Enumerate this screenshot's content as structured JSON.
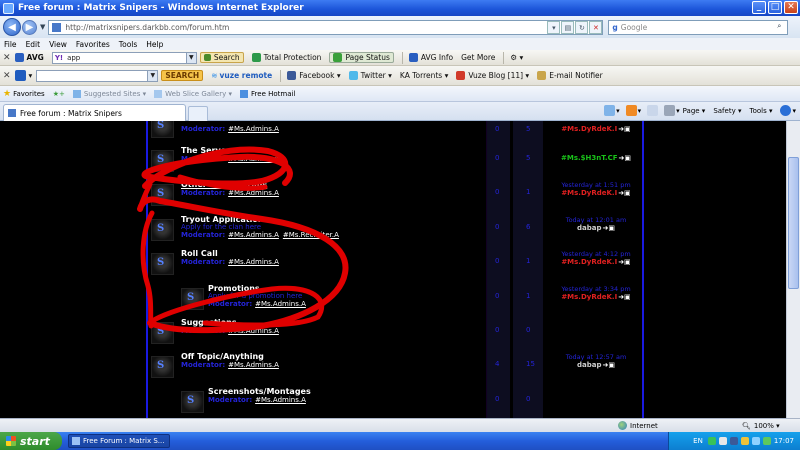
{
  "window": {
    "title": "Free forum : Matrix Snipers - Windows Internet Explorer",
    "url": "http://matrixsnipers.darkbb.com/forum.htm",
    "search_placeholder": "Google"
  },
  "menubar": [
    "File",
    "Edit",
    "View",
    "Favorites",
    "Tools",
    "Help"
  ],
  "avg_toolbar": {
    "brand": "AVG",
    "search_value": "app",
    "search_button": "Search",
    "total_protection": "Total Protection",
    "page_status": "Page Status",
    "avg_info": "AVG Info",
    "get_more": "Get More"
  },
  "vuze_toolbar": {
    "search_button": "SEARCH",
    "vuze_remote": "vuze remote",
    "facebook": "Facebook",
    "twitter": "Twitter",
    "ka_torrents": "KA Torrents",
    "vuze_blog": "Vuze Blog [11]",
    "email_notifier": "E-mail Notifier"
  },
  "favorites_bar": {
    "favorites": "Favorites",
    "suggested": "Suggested Sites",
    "web_slice": "Web Slice Gallery",
    "hotmail": "Free Hotmail"
  },
  "tab": {
    "label": "Free forum : Matrix Snipers"
  },
  "command_bar": {
    "page": "Page",
    "safety": "Safety",
    "tools": "Tools"
  },
  "forum": {
    "moderator_label": "Moderator:",
    "rows": [
      {
        "name": "The Servers",
        "moderators": [
          "#Ms.Admins.A"
        ],
        "topics": "0",
        "posts": "5",
        "last_date": "",
        "last_user": "#Ms.$H3nT.CF",
        "last_user_color": "#19c219"
      },
      {
        "name": "Other Clans/Scrims",
        "moderators": [
          "#Ms.Admins.A"
        ],
        "topics": "0",
        "posts": "1",
        "last_date": "Yesterday at 1:51 pm",
        "last_user": "#Ms.DyRdeK.I",
        "last_user_color": "#e02020"
      },
      {
        "name": "Tryout Applications",
        "description": "Apply for the clan here",
        "moderators": [
          "#Ms.Admins.A",
          "#Ms.Recruiter.A"
        ],
        "topics": "0",
        "posts": "6",
        "last_date": "Today at 12:01 am",
        "last_user": "dabap",
        "last_user_color": "#cfcfcf"
      },
      {
        "name": "Roll Call",
        "moderators": [
          "#Ms.Admins.A"
        ],
        "topics": "0",
        "posts": "1",
        "last_date": "Yesterday at 4:12 pm",
        "last_user": "#Ms.DyRdeK.I",
        "last_user_color": "#e02020"
      },
      {
        "name": "Promotions",
        "description": "Apply for a promotion here",
        "moderators": [
          "#Ms.Admins.A"
        ],
        "topics": "0",
        "posts": "1",
        "last_date": "Yesterday at 3:34 pm",
        "last_user": "#Ms.DyRdeK.I",
        "last_user_color": "#e02020"
      },
      {
        "name": "Suggestions",
        "moderators": [
          "#Ms.Admins.A"
        ],
        "topics": "0",
        "posts": "0",
        "last_date": "",
        "last_user": "",
        "last_user_color": "#ffffff"
      },
      {
        "name": "Off Topic/Anything",
        "moderators": [
          "#Ms.Admins.A"
        ],
        "topics": "4",
        "posts": "15",
        "last_date": "Today at 12:57 am",
        "last_user": "dabap",
        "last_user_color": "#cfcfcf"
      },
      {
        "name": "Screenshots/Montages",
        "moderators": [
          "#Ms.Admins.A"
        ],
        "topics": "0",
        "posts": "0",
        "last_date": "",
        "last_user": "",
        "last_user_color": "#ffffff"
      }
    ],
    "partial_top": {
      "moderators": [
        "#Ms.Admins.A"
      ],
      "topics": "0",
      "posts": "5",
      "last_user": "#Ms.DyRdeK.I"
    }
  },
  "statusbar": {
    "zone": "Internet",
    "zoom": "100%"
  },
  "taskbar": {
    "start": "start",
    "task": "Free Forum : Matrix S...",
    "lang": "EN",
    "time": "17:07"
  }
}
